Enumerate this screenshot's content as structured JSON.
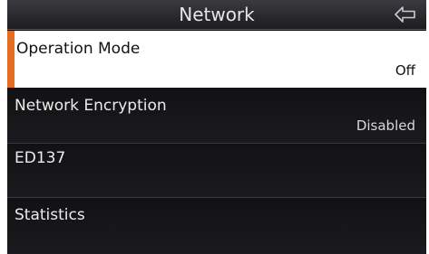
{
  "header": {
    "title": "Network",
    "back_icon": "back-arrow-icon"
  },
  "menu": {
    "items": [
      {
        "label": "Operation Mode",
        "value": "Off"
      },
      {
        "label": "Network Encryption",
        "value": "Disabled"
      },
      {
        "label": "ED137",
        "value": ""
      },
      {
        "label": "Statistics",
        "value": ""
      }
    ]
  },
  "colors": {
    "accent": "#e36e22",
    "selected_background": "#ffffff",
    "list_background": "#151518",
    "header_background": "#2e2e32"
  }
}
